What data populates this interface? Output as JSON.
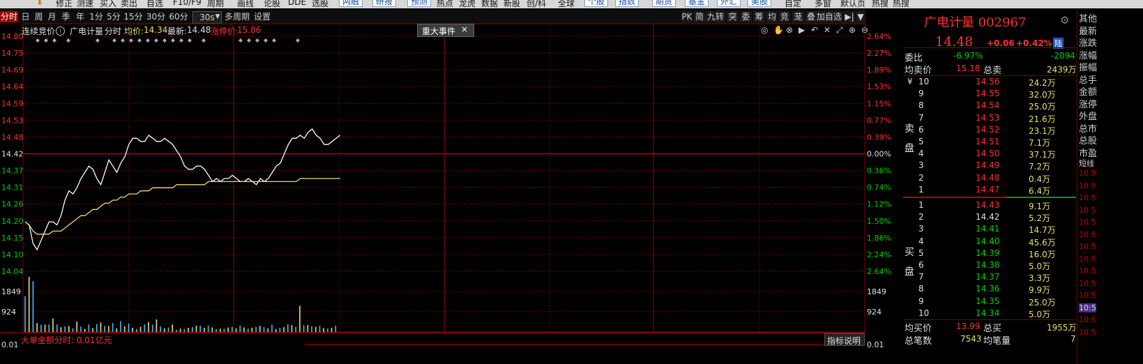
{
  "menu": {
    "items": [
      "修正",
      "测速",
      "买入",
      "卖出",
      "自选",
      "F10/F9",
      "周期",
      "画线",
      "论股",
      "DDE",
      "选股",
      "两融",
      "研报",
      "预测",
      "热点",
      "龙虎",
      "数据",
      "新股",
      "创/科",
      "全球",
      "个股",
      "指数",
      "期货",
      "基金",
      "外汇",
      "美股",
      "自定",
      "多窗",
      "默认页",
      "热搜",
      "热搜"
    ]
  },
  "periods": {
    "buttons": [
      "分时",
      "日",
      "周",
      "月",
      "季",
      "年",
      "1分",
      "5分",
      "15分",
      "30分",
      "60分",
      "30s",
      "多周期",
      "设置"
    ],
    "selected": "分时",
    "dropdown_arrow": "▼"
  },
  "right_tools": [
    "PK",
    "简",
    "九转",
    "突",
    "委",
    "筹",
    "均",
    "竞",
    "茏",
    "叠",
    "加自选",
    "▶|",
    "▼"
  ],
  "info": {
    "auction": "连续竞价",
    "stock_name": "广电计量",
    "mode": "分时",
    "avg_label": "均价:",
    "avg_value": "14.34",
    "latest_label": "最新:",
    "latest_value": "14.48",
    "limit_label": "涨停价:",
    "limit_value": "15.86",
    "event_tab": "重大事件",
    "event_close": "×"
  },
  "left_axis": [
    "14.80",
    "14.75",
    "14.69",
    "14.64",
    "14.59",
    "14.53",
    "14.48",
    "14.42",
    "14.37",
    "14.31",
    "14.26",
    "14.20",
    "14.15",
    "14.10",
    "14.04",
    "1849",
    "924",
    "0.01"
  ],
  "right_axis": [
    "2.64%",
    "2.27%",
    "1.89%",
    "1.53%",
    "1.15%",
    "0.77%",
    "0.39%",
    "0.00%",
    "0.36%",
    "0.74%",
    "1.12%",
    "1.50%",
    "1.86%",
    "2.24%",
    "2.64%",
    "1849",
    "924",
    "0.01"
  ],
  "footer": {
    "big_order": "大单金额分时: 0.01亿元",
    "indicator_help": "指标说明"
  },
  "colors": {
    "up": "#ff3030",
    "down": "#00d000",
    "price_line": "#ffffff",
    "avg_line": "#e8e070",
    "grid": "#7a0000"
  },
  "chart_data": {
    "type": "line",
    "series": [
      {
        "values": [
          14.2,
          14.19,
          14.13,
          14.11,
          14.14,
          14.17,
          14.2,
          14.2,
          14.19,
          14.22,
          14.27,
          14.3,
          14.29,
          14.31,
          14.34,
          14.36,
          14.38,
          14.37,
          14.34,
          14.32,
          14.36,
          14.4,
          14.38,
          14.36,
          14.39,
          14.41,
          14.45,
          14.47,
          14.47,
          14.46,
          14.46,
          14.48,
          14.47,
          14.46,
          14.46,
          14.47,
          14.46,
          14.45,
          14.43,
          14.41,
          14.38,
          14.37,
          14.37,
          14.38,
          14.38,
          14.37,
          14.35,
          14.33,
          14.34,
          14.33,
          14.34,
          14.34,
          14.35,
          14.34,
          14.33,
          14.33,
          14.34,
          14.33,
          14.32,
          14.34,
          14.33,
          14.34,
          14.36,
          14.38,
          14.39,
          14.42,
          14.45,
          14.47,
          14.47,
          14.48,
          14.47,
          14.49,
          14.5,
          14.48,
          14.47,
          14.45,
          14.45,
          14.46,
          14.47,
          14.48
        ]
      },
      {
        "values": [
          14.2,
          14.19,
          14.17,
          14.16,
          14.16,
          14.16,
          14.16,
          14.17,
          14.17,
          14.17,
          14.18,
          14.19,
          14.2,
          14.21,
          14.22,
          14.22,
          14.23,
          14.24,
          14.24,
          14.25,
          14.26,
          14.26,
          14.27,
          14.27,
          14.28,
          14.28,
          14.29,
          14.29,
          14.29,
          14.3,
          14.3,
          14.3,
          14.31,
          14.31,
          14.31,
          14.31,
          14.31,
          14.31,
          14.32,
          14.32,
          14.32,
          14.32,
          14.32,
          14.32,
          14.32,
          14.32,
          14.33,
          14.33,
          14.33,
          14.33,
          14.33,
          14.33,
          14.33,
          14.33,
          14.33,
          14.33,
          14.33,
          14.33,
          14.33,
          14.33,
          14.33,
          14.33,
          14.33,
          14.33,
          14.33,
          14.33,
          14.33,
          14.33,
          14.33,
          14.34,
          14.34,
          14.34,
          14.34,
          14.34,
          14.34,
          14.34,
          14.34,
          14.34,
          14.34,
          14.34
        ]
      }
    ],
    "ylim": [
      14.04,
      14.8
    ],
    "prev_close": 14.42,
    "volume": [
      1200,
      1850,
      1700,
      300,
      240,
      250,
      250,
      450,
      250,
      160,
      180,
      200,
      120,
      350,
      180,
      100,
      250,
      130,
      260,
      320,
      200,
      200,
      300,
      120,
      360,
      190,
      280,
      140,
      100,
      170,
      250,
      330,
      240,
      420,
      180,
      120,
      150,
      250,
      70,
      110,
      100,
      140,
      160,
      210,
      210,
      140,
      210,
      150,
      100,
      110,
      110,
      150,
      170,
      120,
      210,
      150,
      110,
      140,
      170,
      200,
      160,
      120,
      240,
      100,
      140,
      160,
      260,
      230,
      170,
      880,
      220,
      230,
      190,
      170,
      200,
      130,
      110,
      140,
      210
    ],
    "volume_ylim": [
      0,
      2200
    ],
    "volume_labels": [
      "1849",
      "924",
      "0.01"
    ]
  },
  "quote": {
    "title": "广电计量 002967",
    "price": "14.48",
    "change": "+0.06",
    "pct": "+0.42%",
    "board_tag": "陆",
    "webi_label": "委比",
    "webi_value": "-6.97%",
    "webi_diff": "-2094",
    "ask_avg_label": "均卖价",
    "ask_avg_value": "15.18",
    "ask_total_label": "总卖",
    "ask_total_value": "2439万",
    "sell_side_label": "卖盘",
    "yen": "¥",
    "asks": [
      {
        "lvl": "10",
        "price": "14.56",
        "vol": "24.2万"
      },
      {
        "lvl": "9",
        "price": "14.55",
        "vol": "32.0万"
      },
      {
        "lvl": "8",
        "price": "14.54",
        "vol": "25.0万"
      },
      {
        "lvl": "7",
        "price": "14.53",
        "vol": "21.6万"
      },
      {
        "lvl": "6",
        "price": "14.52",
        "vol": "23.1万"
      },
      {
        "lvl": "5",
        "price": "14.51",
        "vol": "7.1万"
      },
      {
        "lvl": "4",
        "price": "14.50",
        "vol": "37.1万"
      },
      {
        "lvl": "3",
        "price": "14.49",
        "vol": "7.2万"
      },
      {
        "lvl": "2",
        "price": "14.48",
        "vol": "0.4万"
      },
      {
        "lvl": "1",
        "price": "14.47",
        "vol": "6.4万"
      }
    ],
    "buy_side_label": "买盘",
    "bids": [
      {
        "lvl": "1",
        "price": "14.43",
        "vol": "9.1万"
      },
      {
        "lvl": "2",
        "price": "14.42",
        "vol": "5.2万"
      },
      {
        "lvl": "3",
        "price": "14.41",
        "vol": "14.7万"
      },
      {
        "lvl": "4",
        "price": "14.40",
        "vol": "45.6万"
      },
      {
        "lvl": "5",
        "price": "14.39",
        "vol": "16.0万"
      },
      {
        "lvl": "6",
        "price": "14.38",
        "vol": "5.0万"
      },
      {
        "lvl": "7",
        "price": "14.37",
        "vol": "3.3万"
      },
      {
        "lvl": "8",
        "price": "14.36",
        "vol": "9.9万"
      },
      {
        "lvl": "9",
        "price": "14.35",
        "vol": "25.0万"
      },
      {
        "lvl": "10",
        "price": "14.34",
        "vol": "5.0万"
      }
    ],
    "bid_avg_label": "均买价",
    "bid_avg_value": "13.99",
    "bid_total_label": "总买",
    "bid_total_value": "1955万",
    "trades_label": "总笔数",
    "trades_value": "7543",
    "avg_trade_label": "均笔量",
    "avg_trade_value": "7"
  },
  "side_panel": {
    "labels": [
      "其他",
      "最新",
      "涨跌",
      "涨幅",
      "振幅",
      "总手",
      "金额",
      "涨停",
      "外盘",
      "总市",
      "总股",
      "市盈"
    ],
    "short_label": "短线",
    "times": [
      "10:5",
      "10:5",
      "10:5",
      "10:5",
      "10:5",
      "10:5",
      "10:5",
      "10:5",
      "10:5",
      "10:5",
      "10:5",
      "10:5",
      "10:5",
      "10:5"
    ]
  }
}
